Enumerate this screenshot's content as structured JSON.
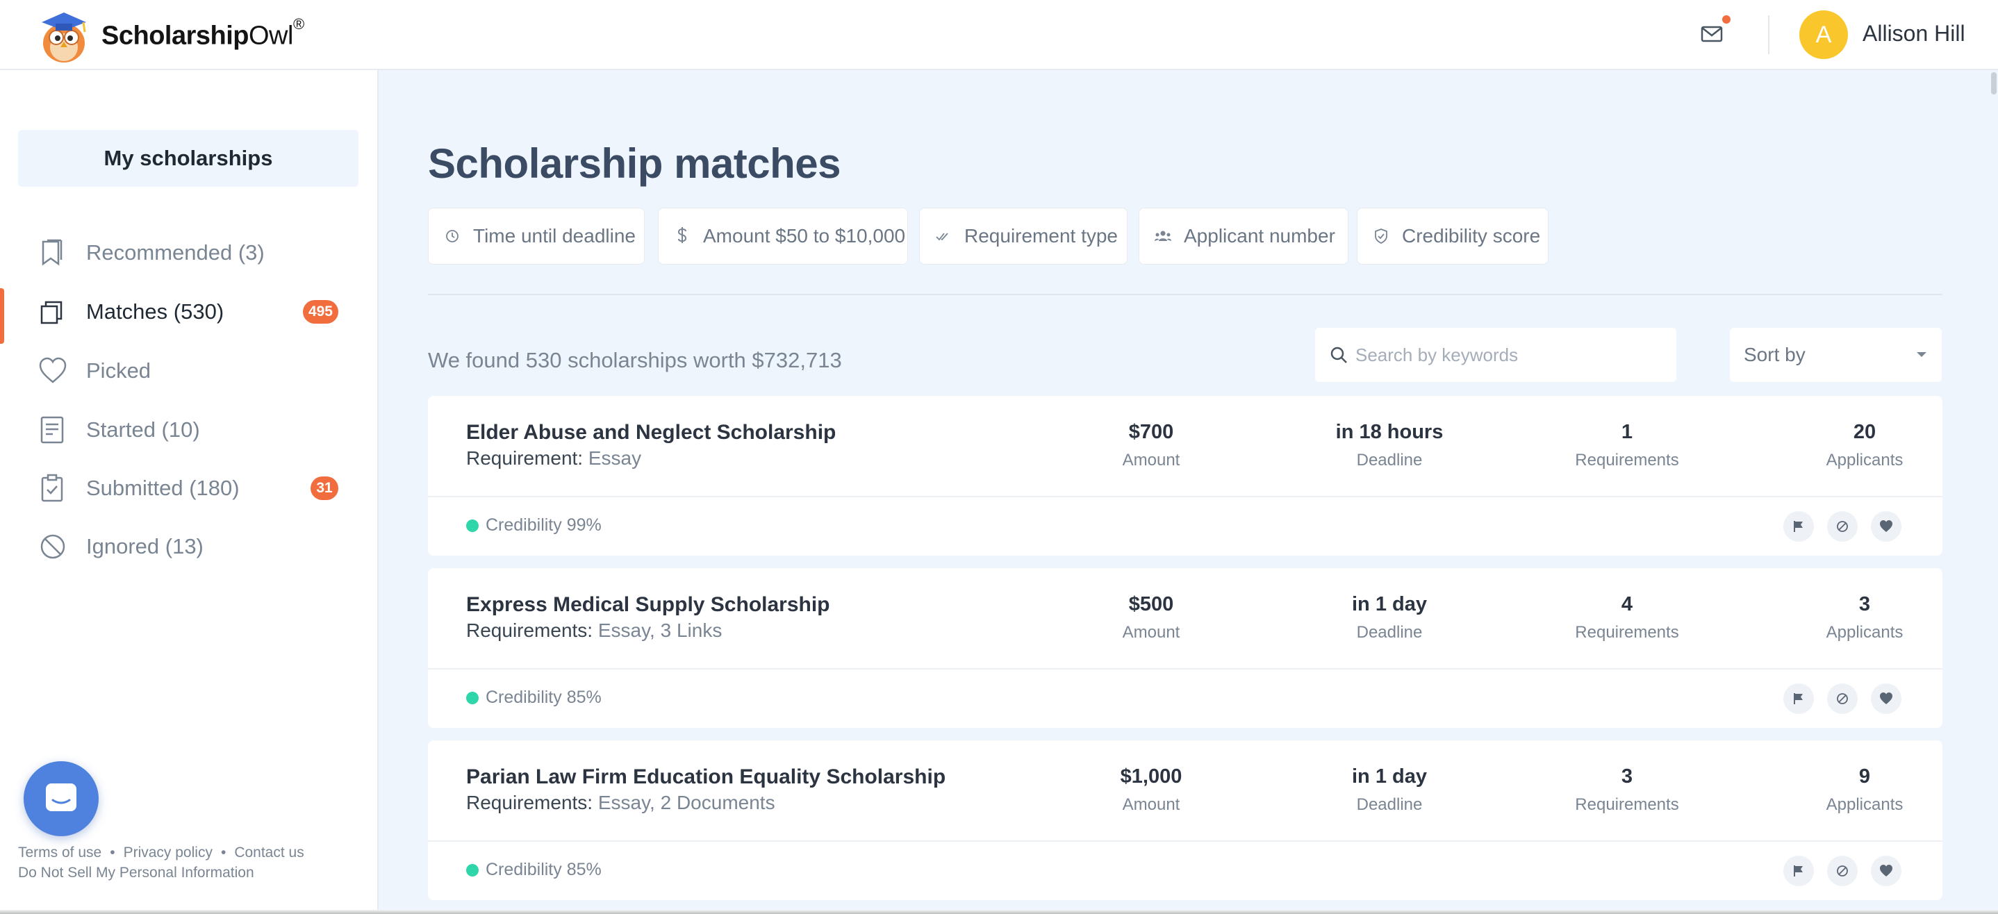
{
  "header": {
    "logo": {
      "brand_bold": "Scholarship",
      "brand_light": "Owl",
      "registered": "®"
    },
    "user": {
      "avatar_initial": "A",
      "name": "Allison Hill"
    },
    "icons": {
      "mail": "mail-icon"
    }
  },
  "sidebar": {
    "section_title": "My scholarships",
    "items": [
      {
        "label": "Recommended  (3)",
        "icon": "bookmark-icon",
        "active": false,
        "badge": ""
      },
      {
        "label": "Matches  (530)",
        "icon": "stack-icon",
        "active": true,
        "badge": "495"
      },
      {
        "label": "Picked",
        "icon": "heart-icon",
        "active": false,
        "badge": ""
      },
      {
        "label": "Started  (10)",
        "icon": "document-icon",
        "active": false,
        "badge": ""
      },
      {
        "label": "Submitted  (180)",
        "icon": "clipboard-check-icon",
        "active": false,
        "badge": "31"
      },
      {
        "label": "Ignored  (13)",
        "icon": "ban-icon",
        "active": false,
        "badge": ""
      }
    ],
    "footer": {
      "terms": "Terms of use",
      "privacy": "Privacy policy",
      "contact": "Contact us",
      "do_not_sell": "Do Not Sell My Personal Information",
      "separator": "•"
    }
  },
  "main": {
    "title": "Scholarship matches",
    "filters": [
      {
        "label": "Time until deadline",
        "icon": "clock-icon"
      },
      {
        "label": "Amount $50 to $10,000",
        "icon": "dollar-icon"
      },
      {
        "label": "Requirement type",
        "icon": "double-check-icon"
      },
      {
        "label": "Applicant number",
        "icon": "people-icon"
      },
      {
        "label": "Credibility score",
        "icon": "shield-icon"
      }
    ],
    "found_text": "We found 530 scholarships worth $732,713",
    "search": {
      "placeholder": "Search by keywords",
      "value": ""
    },
    "sort": {
      "label": "Sort by"
    },
    "stat_labels": {
      "amount": "Amount",
      "deadline": "Deadline",
      "requirements": "Requirements",
      "applicants": "Applicants"
    },
    "cards": [
      {
        "title": "Elder Abuse and Neglect Scholarship",
        "req_label": "Requirement:",
        "req_value": "Essay",
        "amount": "$700",
        "deadline": "in 18 hours",
        "requirements": "1",
        "applicants": "20",
        "credibility": "Credibility 99%"
      },
      {
        "title": "Express Medical Supply Scholarship",
        "req_label": "Requirements:",
        "req_value": "Essay, 3 Links",
        "amount": "$500",
        "deadline": "in 1 day",
        "requirements": "4",
        "applicants": "3",
        "credibility": "Credibility 85%"
      },
      {
        "title": "Parian Law Firm Education Equality Scholarship",
        "req_label": "Requirements:",
        "req_value": "Essay, 2 Documents",
        "amount": "$1,000",
        "deadline": "in 1 day",
        "requirements": "3",
        "applicants": "9",
        "credibility": "Credibility 85%"
      }
    ],
    "card_actions": [
      "flag-icon",
      "ban-icon",
      "heart-icon"
    ]
  },
  "colors": {
    "accent": "#f26d3d",
    "credibility_dot": "#2fd6a9",
    "avatar": "#f9c62b",
    "chat_button": "#4f82df",
    "page_bg": "#eef5fd",
    "title": "#3a4b63"
  }
}
